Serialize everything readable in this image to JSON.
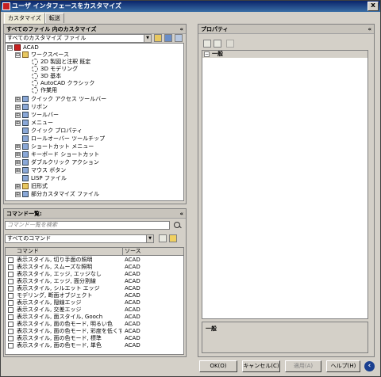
{
  "window": {
    "title": "ユーザ インタフェースをカスタマイズ",
    "close_glyph": "x"
  },
  "tabs": [
    {
      "label": "カスタマイズ",
      "active": true
    },
    {
      "label": "転送",
      "active": false
    }
  ],
  "customize_pane": {
    "header": "すべてのファイル 内のカスタマイズ",
    "file_filter": "すべてのカスタマイズ ファイル",
    "tree": [
      {
        "label": "ACAD",
        "icon": "acad-icon",
        "exp": "⊟"
      },
      {
        "label": "ワークスペース",
        "icon": "folder-icon",
        "exp": "⊟"
      },
      {
        "label": "2D 製図と注釈 既定",
        "icon": "gear-icon",
        "exp": ""
      },
      {
        "label": "3D モデリング",
        "icon": "gear-icon",
        "exp": ""
      },
      {
        "label": "3D 基本",
        "icon": "gear-icon",
        "exp": ""
      },
      {
        "label": "AutoCAD クラシック",
        "icon": "gear-icon",
        "exp": ""
      },
      {
        "label": "作業用",
        "icon": "gear-icon",
        "exp": ""
      },
      {
        "label": "クイック アクセス ツールバー",
        "icon": "toolbar-icon",
        "exp": "⊞"
      },
      {
        "label": "リボン",
        "icon": "ribbon-icon",
        "exp": "⊞"
      },
      {
        "label": "ツールバー",
        "icon": "toolbar-icon",
        "exp": "⊞"
      },
      {
        "label": "メニュー",
        "icon": "menu-icon",
        "exp": "⊞"
      },
      {
        "label": "クイック プロパティ",
        "icon": "properties-icon",
        "exp": ""
      },
      {
        "label": "ロールオーバー ツールチップ",
        "icon": "tooltip-icon",
        "exp": ""
      },
      {
        "label": "ショートカット メニュー",
        "icon": "menu-icon",
        "exp": "⊞"
      },
      {
        "label": "キーボード ショートカット",
        "icon": "keyboard-icon",
        "exp": "⊞"
      },
      {
        "label": "ダブルクリック アクション",
        "icon": "mouse-icon",
        "exp": "⊞"
      },
      {
        "label": "マウス ボタン",
        "icon": "mouse-icon",
        "exp": "⊞"
      },
      {
        "label": "LISP ファイル",
        "icon": "lisp-icon",
        "exp": ""
      },
      {
        "label": "旧形式",
        "icon": "folder-icon",
        "exp": "⊞"
      },
      {
        "label": "部分カスタマイズ ファイル",
        "icon": "file-icon",
        "exp": "⊞"
      }
    ]
  },
  "commands_pane": {
    "header": "コマンド一覧:",
    "search_placeholder": "コマンド一覧を検索",
    "filter": "すべてのコマンド",
    "columns": {
      "command": "コマンド",
      "source": "ソース"
    },
    "rows": [
      {
        "name": "表示スタイル, 切り手面の照明",
        "source": "ACAD"
      },
      {
        "name": "表示スタイル, スムーズな照明",
        "source": "ACAD"
      },
      {
        "name": "表示スタイル, エッジ, エッジなし",
        "source": "ACAD"
      },
      {
        "name": "表示スタイル, エッジ, 面分割線",
        "source": "ACAD"
      },
      {
        "name": "表示スタイル, シルエット エッジ",
        "source": "ACAD"
      },
      {
        "name": "モデリング, 断面オブジェクト",
        "source": "ACAD"
      },
      {
        "name": "表示スタイル, 隠線エッジ",
        "source": "ACAD"
      },
      {
        "name": "表示スタイル, 交差エッジ",
        "source": "ACAD"
      },
      {
        "name": "表示スタイル, 面スタイル, Gooch",
        "source": "ACAD"
      },
      {
        "name": "表示スタイル, 面の色モード, 明るい色",
        "source": "ACAD"
      },
      {
        "name": "表示スタイル, 面の色モード, 彩度を低くす",
        "source": "ACAD"
      },
      {
        "name": "表示スタイル, 面の色モード, 標準",
        "source": "ACAD"
      },
      {
        "name": "表示スタイル, 面の色モード, 単色",
        "source": "ACAD"
      }
    ]
  },
  "properties_pane": {
    "header": "プロパティ",
    "category": "一般",
    "description_title": "一般"
  },
  "buttons": {
    "ok": "OK(O)",
    "cancel": "キャンセル(C)",
    "apply": "適用(A)",
    "help": "ヘルプ(H)"
  },
  "icons": {
    "collapse_chevron": "«",
    "help_arrow": "‹"
  },
  "colors": {
    "title_bar": "#0a246a",
    "acad_red": "#c62020"
  }
}
